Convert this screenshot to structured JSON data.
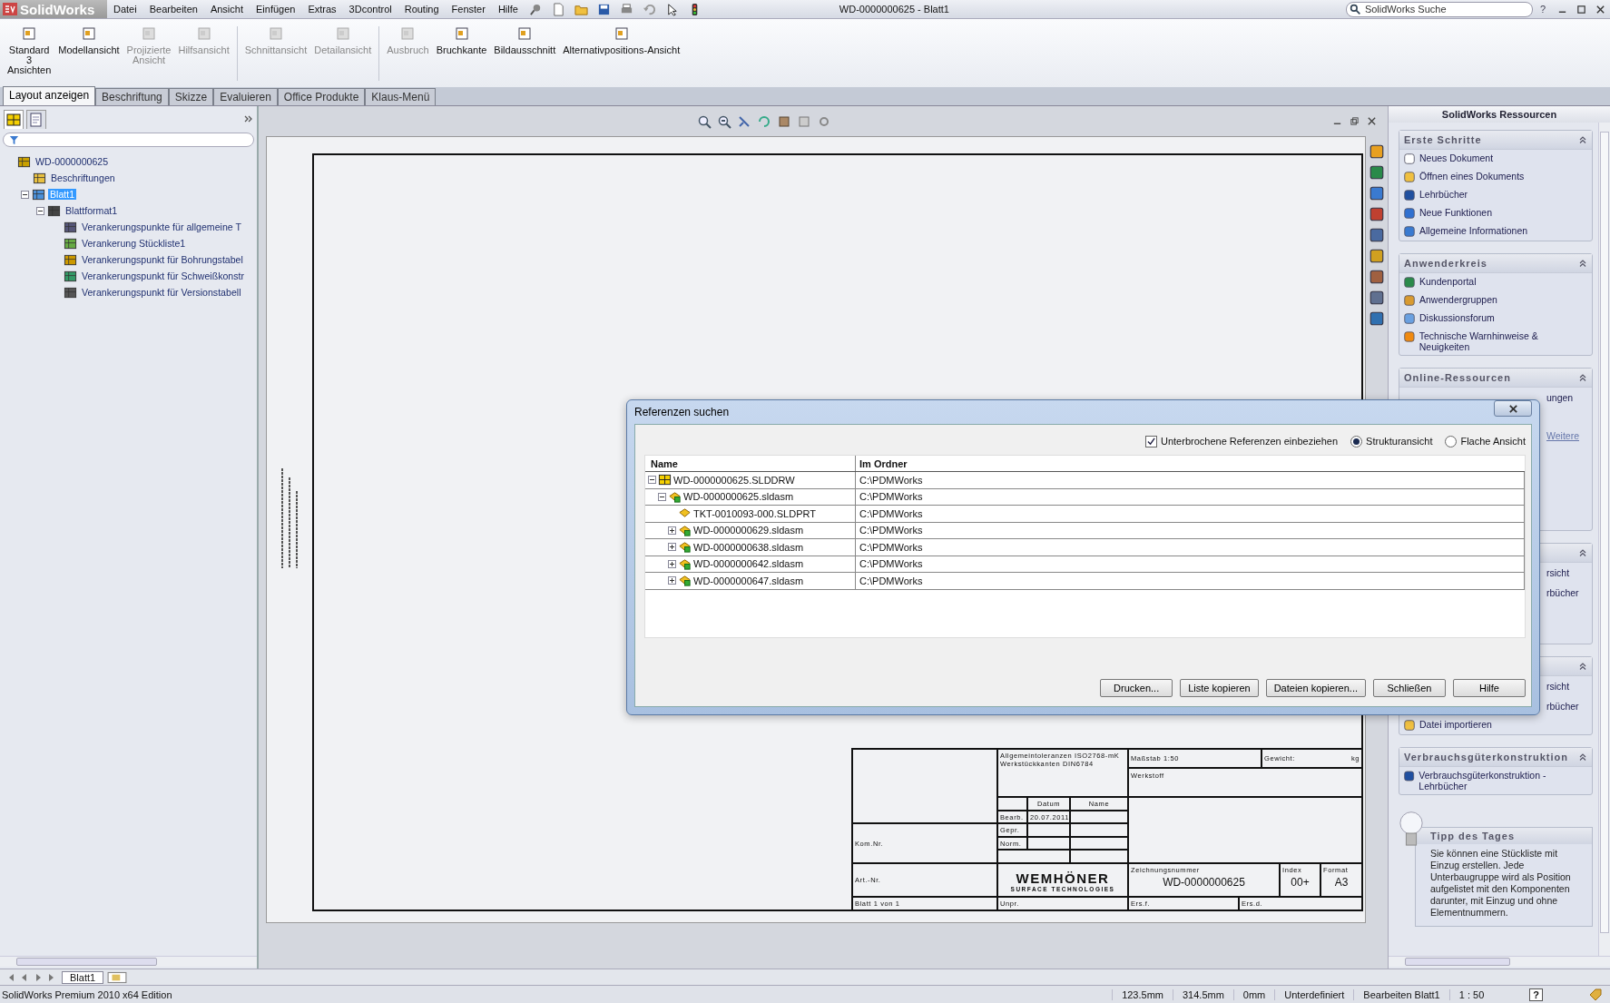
{
  "app": {
    "logo": "SolidWorks",
    "menu": [
      "Datei",
      "Bearbeiten",
      "Ansicht",
      "Einfügen",
      "Extras",
      "3Dcontrol",
      "Routing",
      "Fenster",
      "Hilfe"
    ],
    "title": "WD-0000000625 - Blatt1",
    "search_placeholder": "SolidWorks Suche",
    "help": "?"
  },
  "ribbon": {
    "groups": [
      [
        {
          "lines": [
            "Standard",
            "3",
            "Ansichten"
          ],
          "disabled": false
        },
        {
          "lines": [
            "Modellansicht"
          ],
          "disabled": false
        },
        {
          "lines": [
            "Projizierte",
            "Ansicht"
          ],
          "disabled": true
        },
        {
          "lines": [
            "Hilfsansicht"
          ],
          "disabled": true
        }
      ],
      [
        {
          "lines": [
            "Schnittansicht"
          ],
          "disabled": true
        },
        {
          "lines": [
            "Detailansicht"
          ],
          "disabled": true
        }
      ],
      [
        {
          "lines": [
            "Ausbruch"
          ],
          "disabled": true
        },
        {
          "lines": [
            "Bruchkante"
          ],
          "disabled": false
        },
        {
          "lines": [
            "Bildausschnitt"
          ],
          "disabled": false
        },
        {
          "lines": [
            "Alternativpositions-Ansicht"
          ],
          "disabled": false
        }
      ]
    ]
  },
  "tabs": [
    {
      "label": "Layout anzeigen",
      "selected": true
    },
    {
      "label": "Beschriftung",
      "selected": false
    },
    {
      "label": "Skizze",
      "selected": false
    },
    {
      "label": "Evaluieren",
      "selected": false
    },
    {
      "label": "Office Produkte",
      "selected": false
    },
    {
      "label": "Klaus-Menü",
      "selected": false
    }
  ],
  "feature_tree": [
    {
      "label": "WD-0000000625",
      "kind": "drawing",
      "selected": false,
      "children": [
        {
          "label": "Beschriftungen",
          "kind": "annotations",
          "selected": false
        },
        {
          "label": "Blatt1",
          "kind": "sheet",
          "selected": true,
          "expanded": true,
          "children": [
            {
              "label": "Blattformat1",
              "kind": "format",
              "selected": false,
              "expanded": true,
              "children": [
                {
                  "label": "Verankerungspunkte für allgemeine T",
                  "kind": "table",
                  "selected": false
                },
                {
                  "label": "Verankerung Stückliste1",
                  "kind": "bom",
                  "selected": false
                },
                {
                  "label": "Verankerungspunkt für Bohrungstabel",
                  "kind": "hole",
                  "selected": false
                },
                {
                  "label": "Verankerungspunkt für Schweißkonstr",
                  "kind": "weld",
                  "selected": false
                },
                {
                  "label": "Verankerungspunkt für Versionstabell",
                  "kind": "revision",
                  "selected": false
                }
              ]
            }
          ]
        }
      ]
    }
  ],
  "title_block": {
    "tolerances": [
      "Allgemeintoleranzen ISO2768-mK",
      "Werkstückkanten DIN6784"
    ],
    "scale": "Maßstab 1:50",
    "weight": "Gewicht:",
    "weight_unit": "kg",
    "material": "Werkstoff",
    "date_header": "Datum",
    "name_header": "Name",
    "drawn": "Bearb.",
    "drawn_date": "20.07.2011",
    "checked": "Gepr.",
    "norm": "Norm.",
    "order_no": "Kom.Nr.",
    "article_no": "Art.-Nr.",
    "company": "WEMHÖNER",
    "company_sub": "SURFACE TECHNOLOGIES",
    "drawing_no_label": "Zeichnungsnummer",
    "drawing_no": "WD-0000000625",
    "index_label": "Index",
    "index": "00+",
    "format_label": "Format",
    "format": "A3",
    "sheet": "Blatt 1 von 1",
    "unpr": "Unpr.",
    "replaces": "Ers.f.",
    "replaced_by": "Ers.d."
  },
  "dialog": {
    "title": "Referenzen suchen",
    "include_broken": {
      "label": "Unterbrochene Referenzen einbeziehen",
      "checked": true
    },
    "views": [
      {
        "label": "Strukturansicht",
        "selected": true
      },
      {
        "label": "Flache Ansicht",
        "selected": false
      }
    ],
    "columns": [
      "Name",
      "Im Ordner"
    ],
    "rows": [
      {
        "name": "WD-0000000625.SLDDRW",
        "folder": "C:\\PDMWorks",
        "kind": "drawing",
        "expanded": true,
        "children": [
          {
            "name": "WD-0000000625.sldasm",
            "folder": "C:\\PDMWorks",
            "kind": "assembly",
            "expanded": true,
            "children": [
              {
                "name": "TKT-0010093-000.SLDPRT",
                "folder": "C:\\PDMWorks",
                "kind": "part"
              },
              {
                "name": "WD-0000000629.sldasm",
                "folder": "C:\\PDMWorks",
                "kind": "assembly",
                "expanded": false
              },
              {
                "name": "WD-0000000638.sldasm",
                "folder": "C:\\PDMWorks",
                "kind": "assembly",
                "expanded": false
              },
              {
                "name": "WD-0000000642.sldasm",
                "folder": "C:\\PDMWorks",
                "kind": "assembly",
                "expanded": false
              },
              {
                "name": "WD-0000000647.sldasm",
                "folder": "C:\\PDMWorks",
                "kind": "assembly",
                "expanded": false
              }
            ]
          }
        ]
      }
    ],
    "buttons": [
      "Drucken...",
      "Liste kopieren",
      "Dateien kopieren...",
      "Schließen",
      "Hilfe"
    ]
  },
  "resources": {
    "title": "SolidWorks Ressourcen",
    "sections": [
      {
        "title": "Erste Schritte",
        "items": [
          {
            "label": "Neues Dokument",
            "kind": "document"
          },
          {
            "label": "Öffnen eines Dokuments",
            "kind": "folder"
          },
          {
            "label": "Lehrbücher",
            "kind": "cap"
          },
          {
            "label": "Neue Funktionen",
            "kind": "question"
          },
          {
            "label": "Allgemeine Informationen",
            "kind": "info"
          }
        ]
      },
      {
        "title": "Anwenderkreis",
        "items": [
          {
            "label": "Kundenportal",
            "kind": "globe"
          },
          {
            "label": "Anwendergruppen",
            "kind": "people"
          },
          {
            "label": "Diskussionsforum",
            "kind": "bubble"
          },
          {
            "label": "Technische Warnhinweise & Neuigkeiten",
            "kind": "rss"
          }
        ]
      },
      {
        "title": "Online-Ressourcen",
        "items": [
          {
            "label": "ungen",
            "kind": "covered"
          },
          {
            "label": "Weitere",
            "kind": "covered-link"
          }
        ]
      },
      {
        "items": [
          {
            "label": "rsicht",
            "kind": "covered"
          },
          {
            "label": "rbücher",
            "kind": "covered"
          }
        ]
      },
      {
        "items": [
          {
            "label": "rsicht",
            "kind": "covered"
          },
          {
            "label": "rbücher",
            "kind": "covered"
          },
          {
            "label": "Datei importieren",
            "kind": "folder"
          }
        ]
      },
      {
        "title": "Verbrauchsgüterkonstruktion",
        "items": [
          {
            "label": "Verbrauchsgüterkonstruktion - Lehrbücher",
            "kind": "cap"
          }
        ]
      }
    ],
    "tip": {
      "title": "Tipp des Tages",
      "text": "Sie können eine Stückliste mit Einzug erstellen. Jede Unterbaugruppe wird als Position aufgelistet mit den Komponenten darunter, mit Einzug und ohne Elementnummern."
    }
  },
  "sheet_tabs": [
    {
      "label": "Blatt1",
      "selected": true
    }
  ],
  "status_bar": {
    "edition": "SolidWorks Premium 2010 x64 Edition",
    "cells": [
      "123.5mm",
      "314.5mm",
      "0mm",
      "Unterdefiniert",
      "Bearbeiten Blatt1",
      "1 : 50"
    ],
    "help": "?"
  }
}
